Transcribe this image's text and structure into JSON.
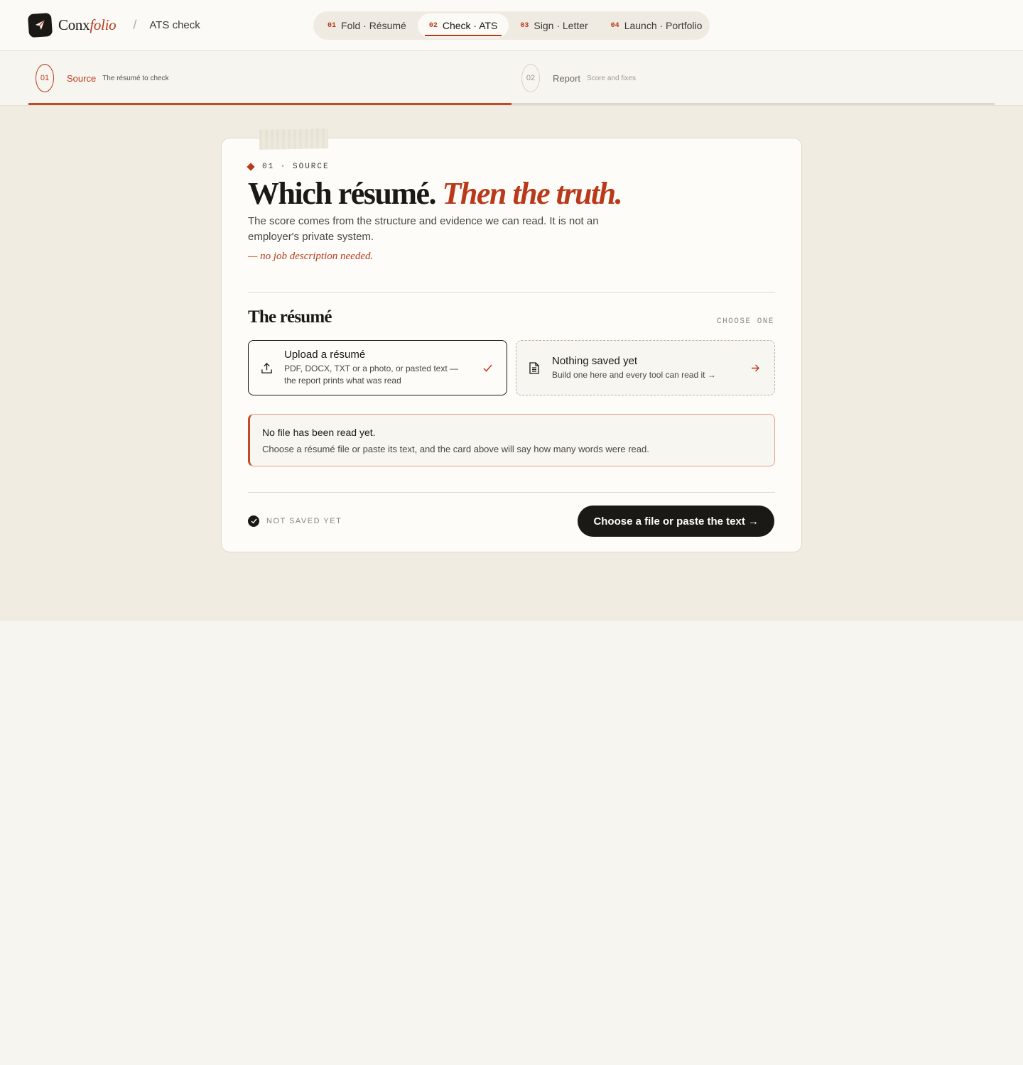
{
  "header": {
    "brand_prefix": "Conx",
    "brand_accent": "folio",
    "breadcrumb": "ATS check",
    "tabs": [
      {
        "num": "01",
        "label": "Fold · Résumé"
      },
      {
        "num": "02",
        "label": "Check · ATS"
      },
      {
        "num": "03",
        "label": "Sign · Letter"
      },
      {
        "num": "04",
        "label": "Launch · Portfolio"
      }
    ],
    "active_tab": "02"
  },
  "stepper": {
    "steps": [
      {
        "num": "01",
        "label": "Source",
        "sub": "The résumé to check"
      },
      {
        "num": "02",
        "label": "Report",
        "sub": "Score and fixes"
      }
    ],
    "progress": 0.5
  },
  "card": {
    "eyebrow": "01 · SOURCE",
    "headline_main": "Which résumé.",
    "headline_accent": "Then the truth.",
    "lede": "The score comes from the structure and evidence we can read. It is not an employer's private system.",
    "note": "— no job description needed.",
    "section_title": "The résumé",
    "section_hint": "CHOOSE ONE",
    "options": {
      "upload": {
        "title": "Upload a résumé",
        "desc": "PDF, DOCX, TXT or a photo, or pasted text — the report prints what was read",
        "icon": "upload-icon",
        "selected": true
      },
      "saved": {
        "title": "Nothing saved yet",
        "desc": "Build one here and every tool can read it →",
        "icon": "document-icon"
      }
    },
    "notice": {
      "title": "No file has been read yet.",
      "body": "Choose a résumé file or paste its text, and the card above will say how many words were read."
    },
    "save_status": "NOT SAVED YET",
    "cta": "Choose a file or paste the text →"
  },
  "colors": {
    "accent": "#b93a1a",
    "ink": "#1a1916",
    "paper": "#fdfcf9",
    "canvas": "#f0ece2"
  }
}
